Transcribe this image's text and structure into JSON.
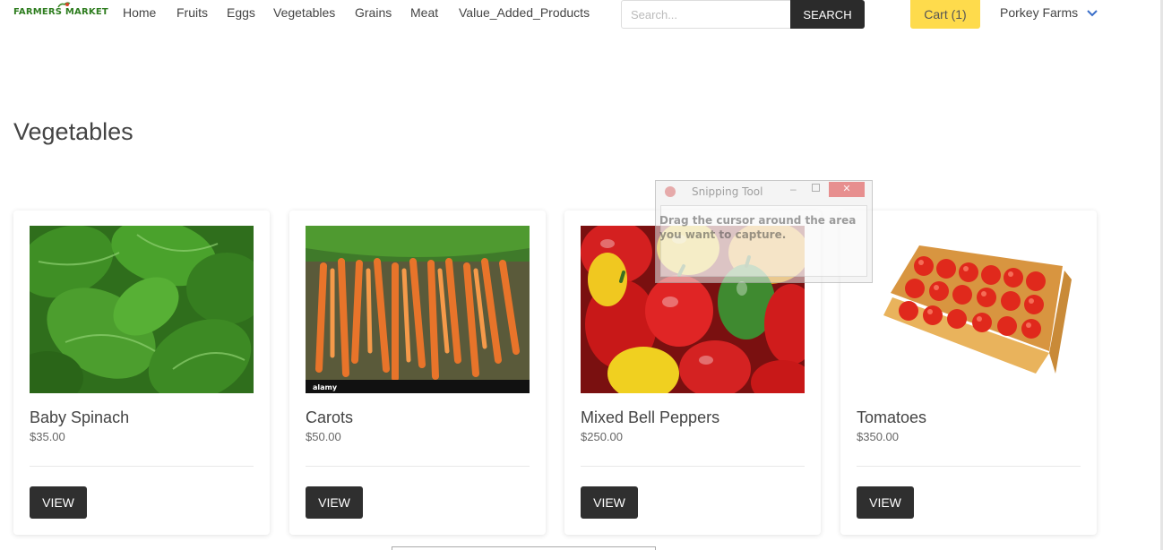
{
  "navbar": {
    "logo_text_1": "FARMERS",
    "logo_text_2": "MARKET",
    "links": [
      "Home",
      "Fruits",
      "Eggs",
      "Vegetables",
      "Grains",
      "Meat",
      "Value_Added_Products"
    ],
    "search_placeholder": "Search...",
    "search_button": "SEARCH",
    "cart_label": "Cart (1)",
    "user_name": "Porkey Farms"
  },
  "page": {
    "title": "Vegetables"
  },
  "products": [
    {
      "name": "Baby Spinach",
      "price": "$35.00",
      "button": "VIEW"
    },
    {
      "name": "Carots",
      "price": "$50.00",
      "button": "VIEW"
    },
    {
      "name": "Mixed Bell Peppers",
      "price": "$250.00",
      "button": "VIEW"
    },
    {
      "name": "Tomatoes",
      "price": "$350.00",
      "button": "VIEW"
    }
  ],
  "snipping_tool": {
    "title": "Snipping Tool",
    "message": "Drag the cursor around the area you want to capture."
  },
  "colors": {
    "cart_yellow": "#fedb4c",
    "dark_button": "#2f2f2f",
    "logo_green": "#2e7d1f"
  }
}
